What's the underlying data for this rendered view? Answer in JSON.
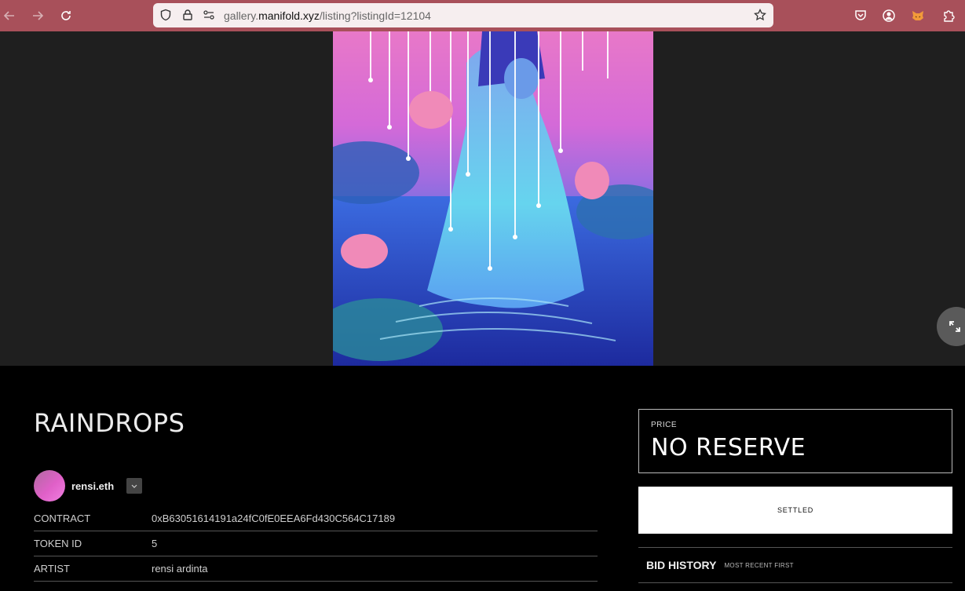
{
  "browser": {
    "url_prefix": "gallery.",
    "url_host": "manifold.xyz",
    "url_path": "/listing?listingId=12104"
  },
  "colors": {
    "chrome": "#a8505a",
    "background": "#000000",
    "stage": "#1f1f1f"
  },
  "listing": {
    "title": "RAINDROPS",
    "artist_handle": "rensi.eth",
    "details": [
      {
        "label": "CONTRACT",
        "value": "0xB63051614191a24fC0fE0EEA6Fd430C564C17189"
      },
      {
        "label": "TOKEN ID",
        "value": "5"
      },
      {
        "label": "ARTIST",
        "value": "rensi ardinta"
      }
    ]
  },
  "sale": {
    "price_label": "PRICE",
    "price_value": "NO RESERVE",
    "status_button": "SETTLED",
    "bid_history_title": "BID HISTORY",
    "bid_history_sort": "MOST RECENT FIRST"
  },
  "icons": {
    "back": "arrow-left-icon",
    "forward": "arrow-right-icon",
    "reload": "reload-icon",
    "shield": "shield-icon",
    "lock": "lock-icon",
    "permissions": "permissions-icon",
    "bookmark": "star-icon",
    "pocket": "pocket-icon",
    "account": "account-icon",
    "metamask": "fox-icon",
    "extensions": "puzzle-icon",
    "fullscreen": "expand-icon",
    "dropdown": "chevron-down-icon"
  }
}
